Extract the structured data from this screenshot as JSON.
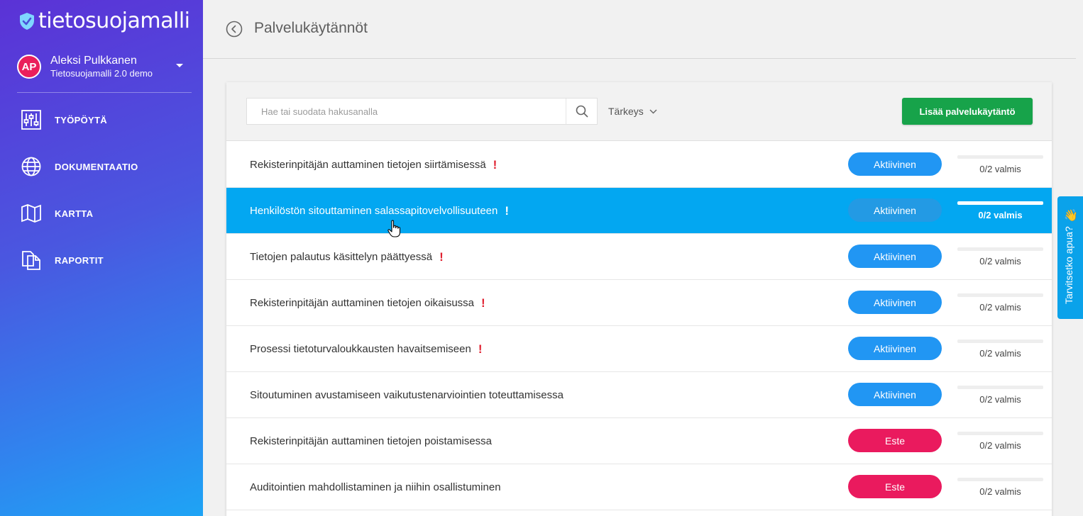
{
  "app": {
    "logo_text": "tietosuojamalli",
    "brand_gradient": [
      "#5b32d6",
      "#1ea4f5"
    ]
  },
  "user": {
    "initials": "AP",
    "name": "Aleksi Pulkkanen",
    "organization": "Tietosuojamalli 2.0 demo"
  },
  "nav": {
    "items": [
      {
        "label": "TYÖPÖYTÄ",
        "icon": "sliders-icon"
      },
      {
        "label": "DOKUMENTAATIO",
        "icon": "globe-icon"
      },
      {
        "label": "KARTTA",
        "icon": "map-icon"
      },
      {
        "label": "RAPORTIT",
        "icon": "documents-icon"
      }
    ]
  },
  "header": {
    "title": "Palvelukäytännöt"
  },
  "toolbar": {
    "search_placeholder": "Hae tai suodata hakusanalla",
    "priority_label": "Tärkeys",
    "add_label": "Lisää palvelukäytäntö"
  },
  "rows": [
    {
      "title": "Rekisterinpitäjän auttaminen tietojen siirtämisessä",
      "important": true,
      "status": "Aktiivinen",
      "status_type": "active",
      "progress": 0,
      "progress_label": "0/2 valmis"
    },
    {
      "title": "Henkilöstön sitouttaminen salassapitovelvollisuuteen",
      "important": true,
      "status": "Aktiivinen",
      "status_type": "active",
      "progress": 0,
      "progress_label": "0/2 valmis",
      "selected": true
    },
    {
      "title": "Tietojen palautus käsittelyn päättyessä",
      "important": true,
      "status": "Aktiivinen",
      "status_type": "active",
      "progress": 0,
      "progress_label": "0/2 valmis"
    },
    {
      "title": "Rekisterinpitäjän auttaminen tietojen oikaisussa",
      "important": true,
      "status": "Aktiivinen",
      "status_type": "active",
      "progress": 0,
      "progress_label": "0/2 valmis"
    },
    {
      "title": "Prosessi tietoturvaloukkausten havaitsemiseen",
      "important": true,
      "status": "Aktiivinen",
      "status_type": "active",
      "progress": 0,
      "progress_label": "0/2 valmis"
    },
    {
      "title": "Sitoutuminen avustamiseen vaikutustenarviointien toteuttamisessa",
      "important": false,
      "status": "Aktiivinen",
      "status_type": "active",
      "progress": 0,
      "progress_label": "0/2 valmis"
    },
    {
      "title": "Rekisterinpitäjän auttaminen tietojen poistamisessa",
      "important": false,
      "status": "Este",
      "status_type": "blocked",
      "progress": 0,
      "progress_label": "0/2 valmis"
    },
    {
      "title": "Auditointien mahdollistaminen ja niihin osallistuminen",
      "important": false,
      "status": "Este",
      "status_type": "blocked",
      "progress": 0,
      "progress_label": "0/2 valmis"
    }
  ],
  "help": {
    "label": "Tarvitsetko apua?",
    "emoji": "👋"
  },
  "colors": {
    "selected_row": "#03a7f1",
    "status_active": "#2196f3",
    "status_blocked": "#ea1a5e",
    "add_button": "#17a34a",
    "important_mark": "#e02030"
  }
}
